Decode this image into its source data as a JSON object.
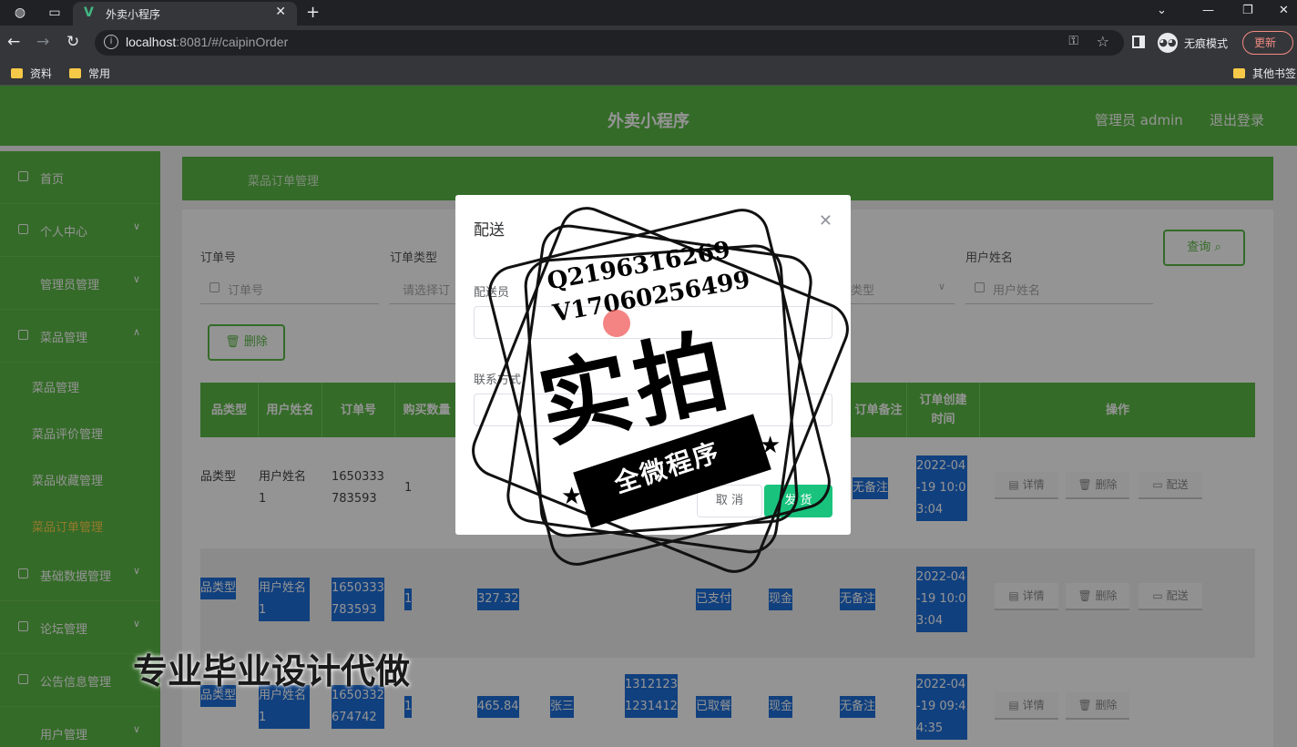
{
  "browser": {
    "tab_title": "外卖小程序",
    "tab_logo": "V",
    "url_host": "localhost",
    "url_rest": ":8081/#/caipinOrder",
    "incognito_label": "无痕模式",
    "update_label": "更新",
    "bookmarks": [
      "资料",
      "常用"
    ],
    "other_bookmarks": "其他书签"
  },
  "header": {
    "title": "外卖小程序",
    "user": "管理员 admin",
    "logout": "退出登录"
  },
  "sidebar": {
    "items": [
      {
        "label": "首页"
      },
      {
        "label": "个人中心"
      },
      {
        "label": "管理员管理"
      },
      {
        "label": "菜品管理"
      }
    ],
    "sub_items": [
      "菜品管理",
      "菜品评价管理",
      "菜品收藏管理",
      "菜品订单管理"
    ],
    "items_after": [
      {
        "label": "基础数据管理"
      },
      {
        "label": "论坛管理"
      },
      {
        "label": "公告信息管理"
      },
      {
        "label": "用户管理"
      }
    ]
  },
  "search": {
    "order_no_label": "订单号",
    "order_no_placeholder": "订单号",
    "order_type_label": "订单类型",
    "order_type_placeholder": "请选择订",
    "third_placeholder": "类型",
    "user_name_label": "用户姓名",
    "user_name_placeholder": "用户姓名",
    "query_button": "查询",
    "delete_button": "删除"
  },
  "table": {
    "headers": [
      "品类型",
      "用户姓名",
      "订单号",
      "购买数量",
      "订单备注",
      "订单创建时间",
      "操作"
    ],
    "rows": [
      {
        "type": "品类型",
        "user": "用户姓名1",
        "order": "1650333783593",
        "qty": "1",
        "price": "",
        "name": "",
        "phone": "",
        "status": "",
        "pay": "",
        "note": "无备注",
        "time": "2022-04-19 10:03:04"
      },
      {
        "type": "品类型",
        "user": "用户姓名1",
        "order": "1650333783593",
        "qty": "1",
        "price": "327.32",
        "name": "",
        "phone": "",
        "status": "已支付",
        "pay": "现金",
        "note": "无备注",
        "time": "2022-04-19 10:03:04"
      },
      {
        "type": "品类型",
        "user": "用户姓名1",
        "order": "1650332674742",
        "qty": "1",
        "price": "465.84",
        "name": "张三",
        "phone": "13121231231412",
        "status": "已取餐",
        "pay": "现金",
        "note": "无备注",
        "time": "2022-04-19 09:44:35"
      }
    ],
    "actions": {
      "detail": "详情",
      "delete": "删除",
      "deliver": "配送"
    }
  },
  "modal": {
    "title": "配送",
    "courier_label": "配送员",
    "contact_label": "联系方式",
    "cancel": "取 消",
    "confirm": "发 货"
  },
  "watermark": {
    "contact_q": "Q2196316269",
    "contact_v": "V17060256499",
    "big_text": "实拍",
    "banner": "全微程序",
    "bottom": "专业毕业设计代做"
  },
  "colors": {
    "primary_green": "#5bb846",
    "highlight_blue": "#1e6fd9",
    "confirm_green": "#19c37d"
  }
}
